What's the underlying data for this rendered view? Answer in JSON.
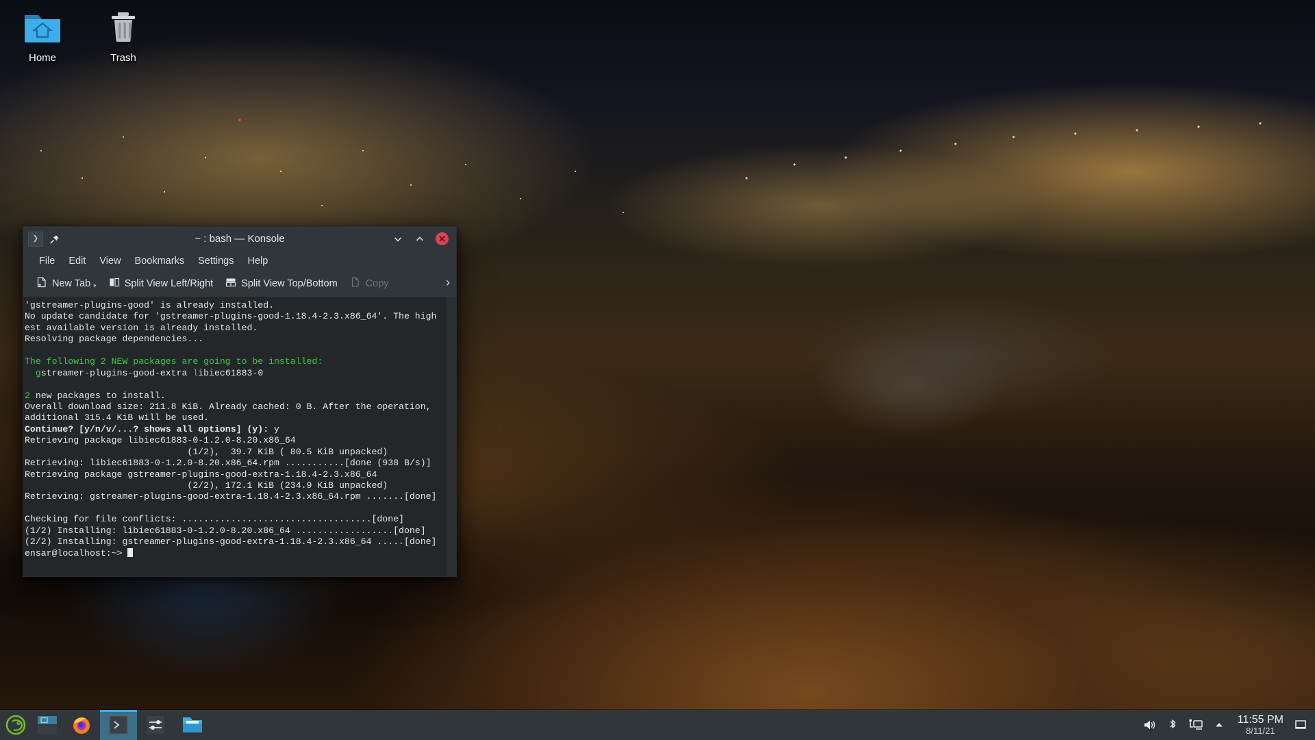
{
  "desktop": {
    "icons": [
      {
        "name": "home-folder",
        "label": "Home"
      },
      {
        "name": "trash",
        "label": "Trash"
      }
    ]
  },
  "konsole": {
    "title": "~ : bash — Konsole",
    "titlebar": {
      "app_icon": "konsole-icon",
      "pin_icon": "pin-icon",
      "minimize_icon": "chevron-down-icon",
      "maximize_icon": "chevron-up-icon",
      "close_icon": "close-icon"
    },
    "menu": [
      "File",
      "Edit",
      "View",
      "Bookmarks",
      "Settings",
      "Help"
    ],
    "toolbar": {
      "new_tab": "New Tab",
      "split_lr": "Split View Left/Right",
      "split_tb": "Split View Top/Bottom",
      "copy": "Copy",
      "overflow": "›"
    },
    "terminal": {
      "lines": [
        {
          "segments": [
            {
              "t": "'gstreamer-plugins-good' is already installed."
            }
          ]
        },
        {
          "segments": [
            {
              "t": "No update candidate for 'gstreamer-plugins-good-1.18.4-2.3.x86_64'. The high"
            }
          ]
        },
        {
          "segments": [
            {
              "t": "est available version is already installed."
            }
          ]
        },
        {
          "segments": [
            {
              "t": "Resolving package dependencies..."
            }
          ]
        },
        {
          "segments": [
            {
              "t": ""
            }
          ]
        },
        {
          "segments": [
            {
              "t": "The following 2 NEW packages are going to be installed:",
              "c": "green"
            }
          ]
        },
        {
          "segments": [
            {
              "t": "  "
            },
            {
              "t": "g",
              "c": "green"
            },
            {
              "t": "streamer-plugins-good-extra "
            },
            {
              "t": "l",
              "c": "green"
            },
            {
              "t": "ibiec61883-0"
            }
          ]
        },
        {
          "segments": [
            {
              "t": ""
            }
          ]
        },
        {
          "segments": [
            {
              "t": "2",
              "c": "green"
            },
            {
              "t": " new packages to install."
            }
          ]
        },
        {
          "segments": [
            {
              "t": "Overall download size: 211.8 KiB. Already cached: 0 B. After the operation,"
            }
          ]
        },
        {
          "segments": [
            {
              "t": "additional 315.4 KiB will be used."
            }
          ]
        },
        {
          "segments": [
            {
              "t": "Continue? [y/n/v/...? shows all options] (y):",
              "b": true
            },
            {
              "t": " y"
            }
          ]
        },
        {
          "segments": [
            {
              "t": "Retrieving package libiec61883-0-1.2.0-8.20.x86_64"
            }
          ]
        },
        {
          "segments": [
            {
              "t": "                              (1/2),  39.7 KiB ( 80.5 KiB unpacked)"
            }
          ]
        },
        {
          "segments": [
            {
              "t": "Retrieving: libiec61883-0-1.2.0-8.20.x86_64.rpm ...........[done (938 B/s)]"
            }
          ]
        },
        {
          "segments": [
            {
              "t": "Retrieving package gstreamer-plugins-good-extra-1.18.4-2.3.x86_64"
            }
          ]
        },
        {
          "segments": [
            {
              "t": "                              (2/2), 172.1 KiB (234.9 KiB unpacked)"
            }
          ]
        },
        {
          "segments": [
            {
              "t": "Retrieving: gstreamer-plugins-good-extra-1.18.4-2.3.x86_64.rpm .......[done]"
            }
          ]
        },
        {
          "segments": [
            {
              "t": ""
            }
          ]
        },
        {
          "segments": [
            {
              "t": "Checking for file conflicts: ...................................[done]"
            }
          ]
        },
        {
          "segments": [
            {
              "t": "(1/2) Installing: libiec61883-0-1.2.0-8.20.x86_64 ..................[done]"
            }
          ]
        },
        {
          "segments": [
            {
              "t": "(2/2) Installing: gstreamer-plugins-good-extra-1.18.4-2.3.x86_64 .....[done]"
            }
          ]
        },
        {
          "segments": [
            {
              "t": "ensar@localhost:~> "
            },
            {
              "cursor": true
            }
          ]
        }
      ]
    }
  },
  "taskbar": {
    "launcher": {
      "name": "opensuse-menu-icon",
      "label": "openSUSE"
    },
    "pager": {
      "name": "pager-widget"
    },
    "tasks": [
      {
        "name": "firefox",
        "label": "Firefox",
        "active": false
      },
      {
        "name": "konsole",
        "label": "Konsole",
        "active": true
      },
      {
        "name": "settings",
        "label": "System Settings",
        "active": false
      },
      {
        "name": "dolphin",
        "label": "Dolphin",
        "active": false
      }
    ],
    "tray": [
      {
        "name": "volume-icon"
      },
      {
        "name": "bluetooth-icon"
      },
      {
        "name": "network-icon"
      },
      {
        "name": "show-hidden-icon"
      }
    ],
    "clock": {
      "time": "11:55 PM",
      "date": "8/11/21"
    },
    "show_desktop": {
      "name": "show-desktop-icon"
    }
  },
  "colors": {
    "accent": "#3daee9",
    "window_bg": "#31363b",
    "terminal_bg": "#242729",
    "terminal_green": "#3fc84a",
    "close_red": "#da4453"
  }
}
